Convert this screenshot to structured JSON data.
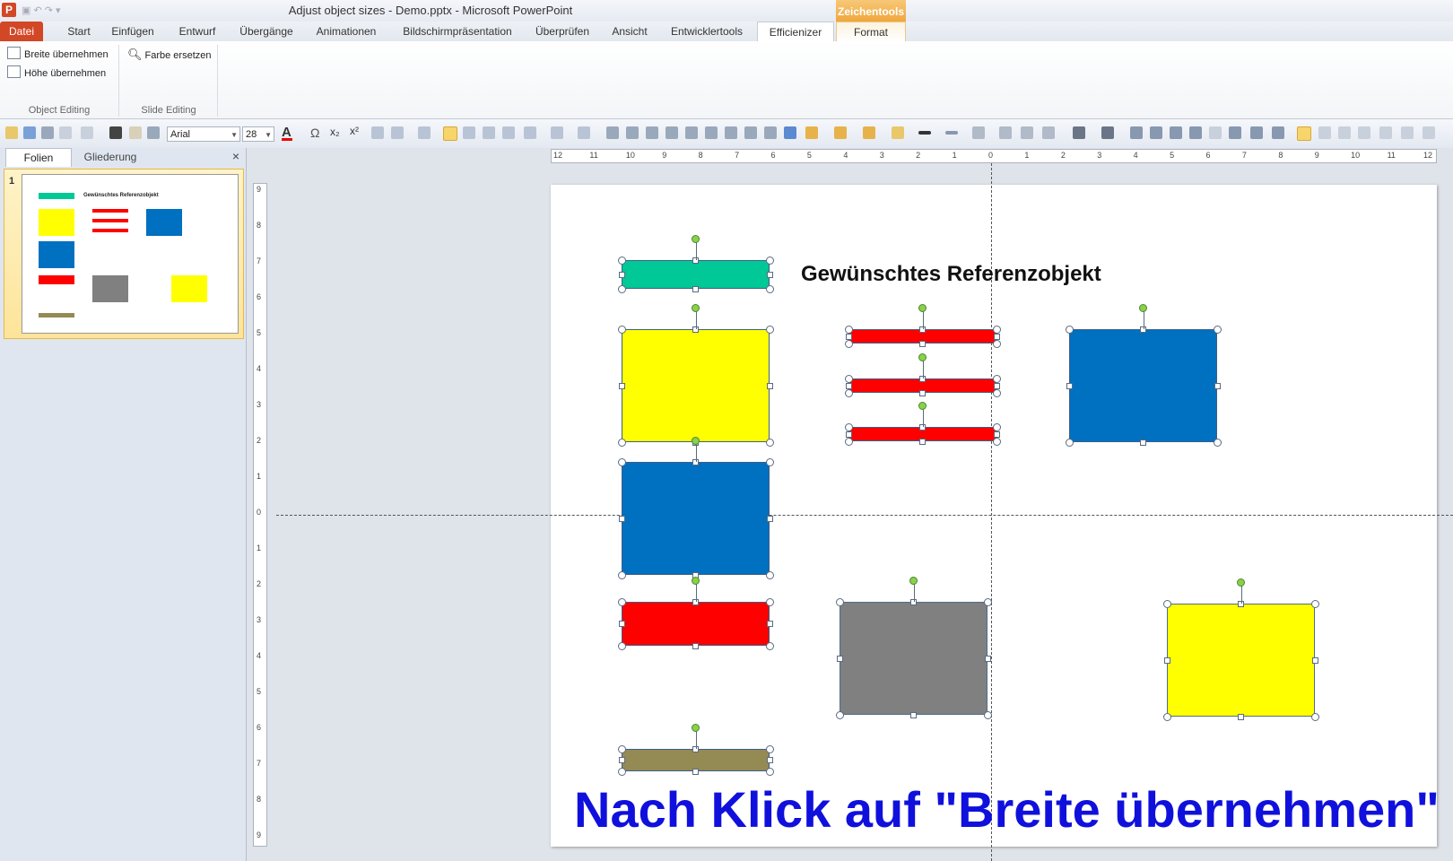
{
  "window": {
    "title": "Adjust object sizes - Demo.pptx  -  Microsoft PowerPoint",
    "context_group": "Zeichentools",
    "app_icon": "P"
  },
  "tabs": [
    {
      "label": "Datei"
    },
    {
      "label": "Start"
    },
    {
      "label": "Einfügen"
    },
    {
      "label": "Entwurf"
    },
    {
      "label": "Übergänge"
    },
    {
      "label": "Animationen"
    },
    {
      "label": "Bildschirmpräsentation"
    },
    {
      "label": "Überprüfen"
    },
    {
      "label": "Ansicht"
    },
    {
      "label": "Entwicklertools"
    },
    {
      "label": "Efficienizer"
    },
    {
      "label": "Format"
    }
  ],
  "ribbon": {
    "object_editing": {
      "label": "Object Editing",
      "width_button": "Breite übernehmen",
      "height_button": "Höhe übernehmen"
    },
    "slide_editing": {
      "label": "Slide Editing",
      "replace_color_button": "Farbe ersetzen"
    }
  },
  "toolbar": {
    "font": "Arial",
    "size": "28"
  },
  "left_pane": {
    "tab_slides": "Folien",
    "tab_outline": "Gliederung",
    "close": "×",
    "slide_number": "1"
  },
  "slide": {
    "reference_label": "Gewünschtes Referenzobjekt",
    "caption": "Nach Klick auf \"Breite übernehmen\"",
    "colors": {
      "green": "#00c896",
      "yellow": "#ffff00",
      "red": "#ff0000",
      "blue": "#0070c0",
      "gray": "#808080",
      "olive": "#948a54",
      "caption": "#1010dd"
    }
  },
  "rulers": {
    "horizontal": [
      "12",
      "11",
      "10",
      "9",
      "8",
      "7",
      "6",
      "5",
      "4",
      "3",
      "2",
      "1",
      "0",
      "1",
      "2",
      "3",
      "4",
      "5",
      "6",
      "7",
      "8",
      "9",
      "10",
      "11",
      "12"
    ],
    "vertical": [
      "9",
      "8",
      "7",
      "6",
      "5",
      "4",
      "3",
      "2",
      "1",
      "0",
      "1",
      "2",
      "3",
      "4",
      "5",
      "6",
      "7",
      "8",
      "9"
    ]
  }
}
